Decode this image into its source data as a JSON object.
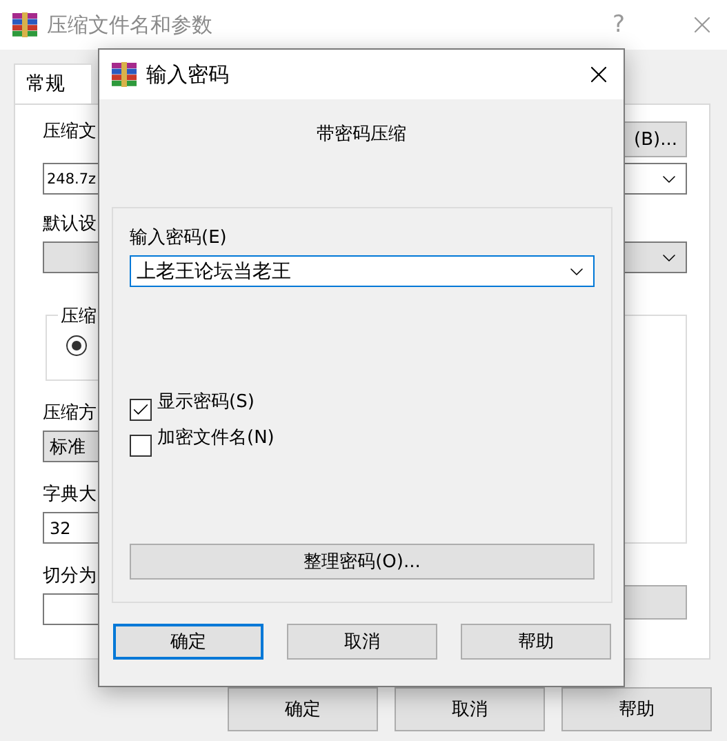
{
  "main_window": {
    "title": "压缩文件名和参数",
    "help": "?",
    "tabs": [
      {
        "label": "常规",
        "selected": true
      }
    ],
    "archive_name_label": "压缩文",
    "browse_button": "(B)...",
    "archive_name": "248.7z",
    "profile_label": "默认设",
    "compression_group_label": "压缩",
    "radio_selected": true,
    "method_label": "压缩方",
    "method": "标准",
    "dictionary_label": "字典大",
    "dictionary": "32",
    "split_label": "切分为",
    "buttons": [
      "确定",
      "取消",
      "帮助"
    ]
  },
  "dialog": {
    "title": "输入密码",
    "heading": "带密码压缩",
    "password_label": "输入密码(E)",
    "password": "上老王论坛当老王",
    "options": [
      {
        "label": "显示密码(S)",
        "checked": true
      },
      {
        "label": "加密文件名(N)",
        "checked": false
      }
    ],
    "organize_button": "整理密码(O)...",
    "buttons": [
      {
        "label": "确定",
        "default": true
      },
      {
        "label": "取消",
        "default": false
      },
      {
        "label": "帮助",
        "default": false
      }
    ]
  }
}
